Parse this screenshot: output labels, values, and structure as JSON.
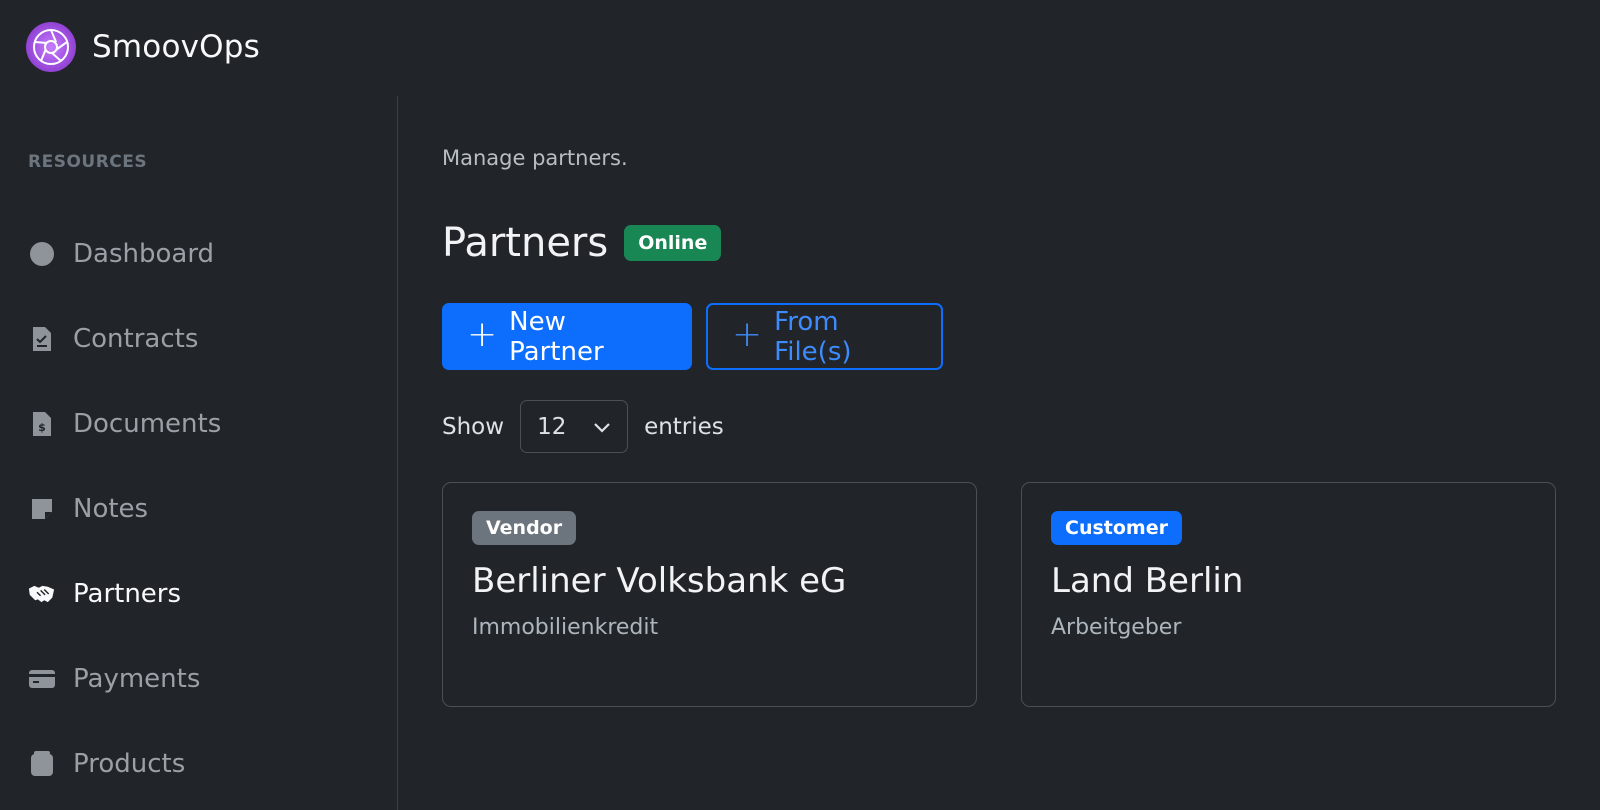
{
  "brand": {
    "name": "SmoovOps"
  },
  "sidebar": {
    "heading": "RESOURCES",
    "items": [
      {
        "label": "Dashboard",
        "icon": "circle-icon",
        "active": false
      },
      {
        "label": "Contracts",
        "icon": "contract-icon",
        "active": false
      },
      {
        "label": "Documents",
        "icon": "document-icon",
        "active": false
      },
      {
        "label": "Notes",
        "icon": "note-icon",
        "active": false
      },
      {
        "label": "Partners",
        "icon": "handshake-icon",
        "active": true
      },
      {
        "label": "Payments",
        "icon": "credit-card-icon",
        "active": false
      },
      {
        "label": "Products",
        "icon": "box-icon",
        "active": false
      }
    ]
  },
  "main": {
    "subtitle": "Manage partners.",
    "title": "Partners",
    "status_badge": "Online",
    "status_color": "#198754",
    "actions": {
      "new_partner": "New Partner",
      "from_files": "From File(s)"
    },
    "entries": {
      "show_label": "Show",
      "selected": "12",
      "suffix_label": "entries"
    },
    "cards": [
      {
        "badge": "Vendor",
        "badge_color": "#6c757d",
        "title": "Berliner Volksbank eG",
        "subtitle": "Immobilienkredit"
      },
      {
        "badge": "Customer",
        "badge_color": "#0d6efd",
        "title": "Land Berlin",
        "subtitle": "Arbeitgeber"
      }
    ]
  },
  "colors": {
    "background": "#212529",
    "primary": "#0d6efd",
    "success": "#198754",
    "brand_accent": "#9d4edd"
  }
}
